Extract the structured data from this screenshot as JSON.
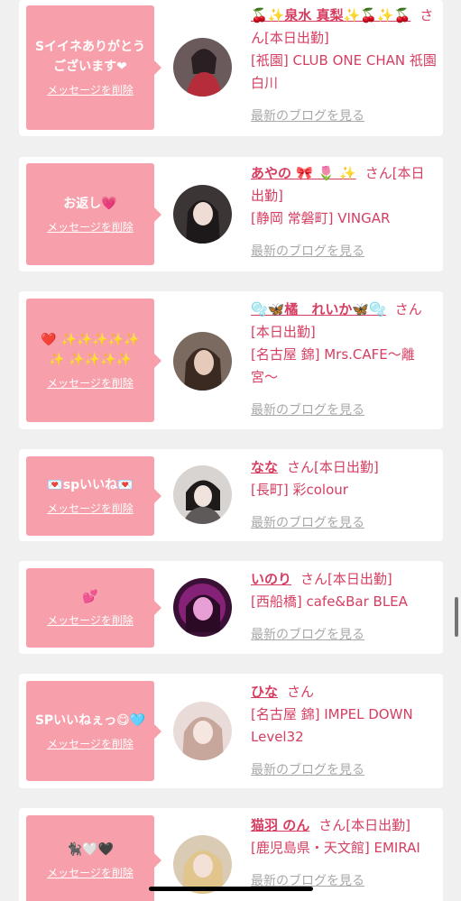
{
  "colors": {
    "accent_pink": "#f7a0ab",
    "name_red": "#d63e61",
    "blog_gray": "#a8a8a8",
    "page_bg": "#f1f0f0"
  },
  "items": [
    {
      "message": "Sイイネありがとうございます❤︎",
      "delete_label": "メッセージを削除",
      "name": "🍒✨泉水 真梨✨🍒✨🍒",
      "suffix": "さん[本日出勤]",
      "shop": "[祇園] CLUB ONE CHAN 祇園白川",
      "blog_label": "最新のブログを見る"
    },
    {
      "message": "お返し💗",
      "delete_label": "メッセージを削除",
      "name": "あやの 🎀 🌷 ✨",
      "suffix": "さん[本日出勤]",
      "shop": "[静岡 常磐町] VINGAR",
      "blog_label": "最新のブログを見る"
    },
    {
      "message": "❤️ ✨✨✨✨✨✨ ✨✨✨✨",
      "delete_label": "メッセージを削除",
      "name": "🫧🦋橘　れいか🦋🫧",
      "suffix": "さん[本日出勤]",
      "shop": "[名古屋 錦] Mrs.CAFE〜離宮〜",
      "blog_label": "最新のブログを見る"
    },
    {
      "message": "💌spいいね💌",
      "delete_label": "メッセージを削除",
      "name": "なな",
      "suffix": "さん[本日出勤]",
      "shop": "[長町] 彩colour",
      "blog_label": "最新のブログを見る"
    },
    {
      "message": "💕",
      "delete_label": "メッセージを削除",
      "name": "いのり",
      "suffix": "さん[本日出勤]",
      "shop": "[西船橋] cafe&Bar BLEA",
      "blog_label": "最新のブログを見る"
    },
    {
      "message": "SPいいねぇっ😋🩵",
      "delete_label": "メッセージを削除",
      "name": "ひな",
      "suffix": "さん",
      "shop": "[名古屋 錦] IMPEL DOWN Level32",
      "blog_label": "最新のブログを見る"
    },
    {
      "message": "🐈‍⬛🤍🖤",
      "delete_label": "メッセージを削除",
      "name": "猫羽 のん",
      "suffix": "さん[本日出勤]",
      "shop": "[鹿児島県・天文館] EMIRAI",
      "blog_label": "最新のブログを見る"
    }
  ]
}
